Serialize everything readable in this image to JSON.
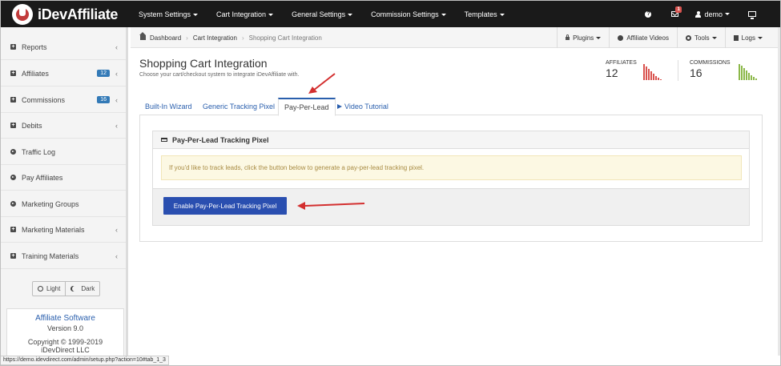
{
  "app": {
    "brand": "iDevAffiliate"
  },
  "topnav": {
    "items": [
      "System Settings",
      "Cart Integration",
      "General Settings",
      "Commission Settings",
      "Templates"
    ],
    "mail_count": "1",
    "user": "demo"
  },
  "sidebar": {
    "items": [
      {
        "label": "Reports",
        "badge": "",
        "icon": "plus-square-icon"
      },
      {
        "label": "Affiliates",
        "badge": "12",
        "icon": "plus-square-icon"
      },
      {
        "label": "Commissions",
        "badge": "16",
        "icon": "plus-square-icon"
      },
      {
        "label": "Debits",
        "badge": "",
        "icon": "plus-square-icon"
      },
      {
        "label": "Traffic Log",
        "badge": "",
        "icon": "circle-arrow-icon"
      },
      {
        "label": "Pay Affiliates",
        "badge": "",
        "icon": "circle-arrow-icon"
      },
      {
        "label": "Marketing Groups",
        "badge": "",
        "icon": "circle-arrow-icon"
      },
      {
        "label": "Marketing Materials",
        "badge": "",
        "icon": "plus-square-icon"
      },
      {
        "label": "Training Materials",
        "badge": "",
        "icon": "plus-square-icon"
      }
    ],
    "theme": {
      "light": "Light",
      "dark": "Dark"
    },
    "version": {
      "title": "Affiliate Software",
      "version": "Version 9.0",
      "copyright": "Copyright © 1999-2019",
      "company": "iDevDirect LLC"
    }
  },
  "breadcrumb": {
    "items": [
      "Dashboard",
      "Cart Integration"
    ],
    "current": "Shopping Cart Integration"
  },
  "tools": {
    "plugins": "Plugins",
    "videos": "Affiliate Videos",
    "tools": "Tools",
    "logs": "Logs"
  },
  "page": {
    "title": "Shopping Cart Integration",
    "subtitle": "Choose your cart/checkout system to integrate iDevAffiliate with."
  },
  "stats": {
    "affiliates": {
      "label": "AFFILIATES",
      "value": "12",
      "color": "#d9534f"
    },
    "commissions": {
      "label": "COMMISSIONS",
      "value": "16",
      "color": "#8cb84a"
    }
  },
  "tabs": [
    "Built-In Wizard",
    "Generic Tracking Pixel",
    "Pay-Per-Lead",
    "Video Tutorial"
  ],
  "panel": {
    "title": "Pay-Per-Lead Tracking Pixel",
    "alert": "If you'd like to track leads, click the button below to generate a pay-per-lead tracking pixel.",
    "button": "Enable Pay-Per-Lead Tracking Pixel"
  },
  "statusbar": {
    "url": "https://demo.idevdirect.com/admin/setup.php?action=10#tab_1_3"
  },
  "colors": {
    "accent": "#2a4fb0",
    "annotation_arrow": "#d32f2f"
  }
}
